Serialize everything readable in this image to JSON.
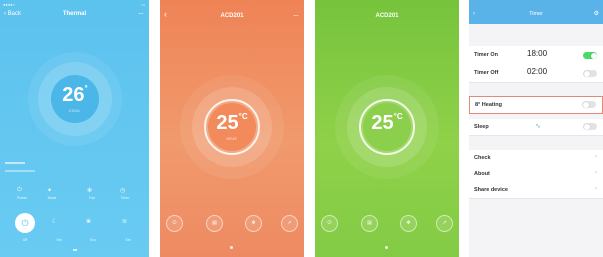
{
  "screens": {
    "main": {
      "back_label": "Back",
      "title": "Thermal",
      "temperature": "26",
      "unit": "°",
      "mode": "COOL",
      "buttons": [
        "Power",
        "Mode",
        "Fan",
        "Timer"
      ],
      "bottom_labels": [
        "Off",
        "Set",
        "Eco",
        "Set"
      ],
      "colors": {
        "background": "#5cc2ee",
        "circle": "#4ab7e8"
      }
    },
    "heat": {
      "title": "ACD201",
      "temperature": "25",
      "unit": "°C",
      "mode": "HEAT",
      "colors": {
        "background": "#ef8356",
        "circle": "#f28a5b"
      }
    },
    "green": {
      "title": "ACD201",
      "temperature": "25",
      "unit": "°C",
      "colors": {
        "background": "#82c944",
        "circle": "#8ccf4c"
      }
    },
    "settings": {
      "title": "Timer",
      "rows": [
        {
          "label": "Timer On",
          "value": "18:00",
          "toggle": true
        },
        {
          "label": "Timer Off",
          "value": "02:00",
          "toggle": false
        },
        {
          "label": "8° Heating",
          "toggle": false,
          "highlight": true
        },
        {
          "label": "Sleep",
          "toggle": false
        }
      ],
      "list": [
        "Check",
        "About",
        "Share device"
      ],
      "colors": {
        "highlight": "#e08a7a",
        "toggle_on": "#4cd964",
        "nav": "#5ab3e8"
      }
    }
  }
}
